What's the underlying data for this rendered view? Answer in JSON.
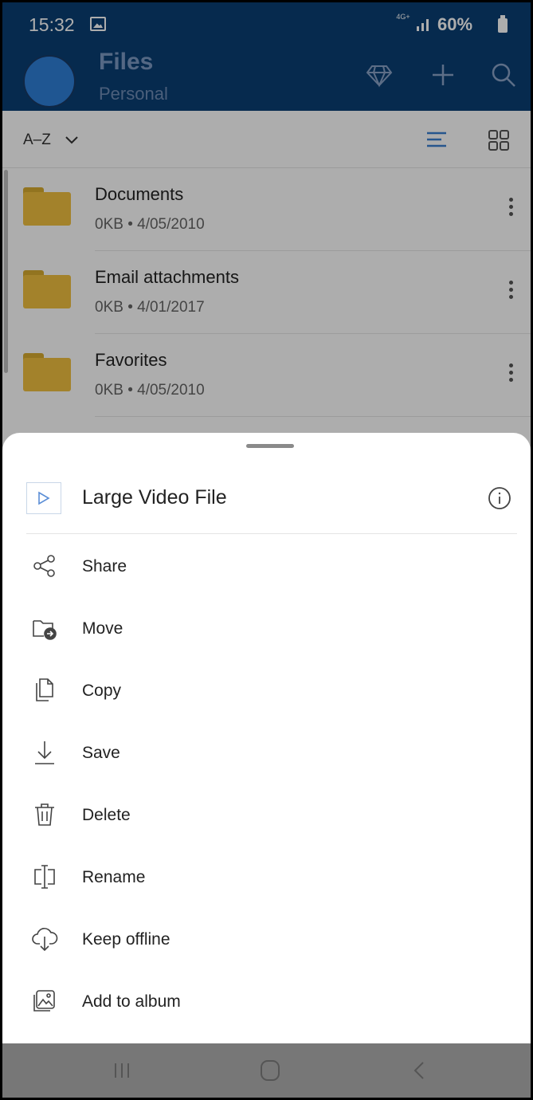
{
  "status_bar": {
    "time": "15:32",
    "network": "4G+",
    "battery": "60%"
  },
  "app_bar": {
    "title": "Files",
    "subtitle": "Personal"
  },
  "sort": {
    "label": "A–Z"
  },
  "files": [
    {
      "name": "Documents",
      "meta": "0KB • 4/05/2010"
    },
    {
      "name": "Email attachments",
      "meta": "0KB • 4/01/2017"
    },
    {
      "name": "Favorites",
      "meta": "0KB • 4/05/2010"
    }
  ],
  "sheet": {
    "title": "Large Video File",
    "actions": [
      {
        "label": "Share",
        "icon": "share-icon"
      },
      {
        "label": "Move",
        "icon": "move-icon"
      },
      {
        "label": "Copy",
        "icon": "copy-icon"
      },
      {
        "label": "Save",
        "icon": "download-icon"
      },
      {
        "label": "Delete",
        "icon": "trash-icon"
      },
      {
        "label": "Rename",
        "icon": "rename-icon"
      },
      {
        "label": "Keep offline",
        "icon": "cloud-download-icon"
      },
      {
        "label": "Add to album",
        "icon": "album-icon"
      }
    ]
  },
  "colors": {
    "app_bar": "#0a3f73",
    "accent": "#2f7fd8",
    "folder": "#f0c040"
  }
}
